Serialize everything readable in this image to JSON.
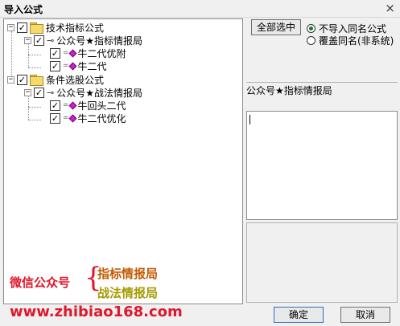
{
  "window": {
    "title": "导入公式",
    "close_glyph": "×"
  },
  "tree": [
    {
      "label": "技术指标公式",
      "expander": "−"
    },
    {
      "label": "公众号★指标情报局",
      "expander": "−"
    },
    {
      "label": "牛二代优附"
    },
    {
      "label": "牛二代"
    },
    {
      "label": "条件选股公式",
      "expander": "−"
    },
    {
      "label": "公众号★战法情报局",
      "expander": "−"
    },
    {
      "label": "牛回头二代"
    },
    {
      "label": "牛二代优化"
    }
  ],
  "check_glyph": "✓",
  "watermark": {
    "wechat": "微信公众号",
    "brace": "{",
    "line1": "指标情报局",
    "line2": "战法情报局",
    "url": "www.zhibiao168.com"
  },
  "select_all_label": "全部选中",
  "options": {
    "no_import": "不导入同名公式",
    "overwrite": "覆盖同名(非系统)"
  },
  "info_title": "公众号★指标情报局",
  "buttons": {
    "ok": "确定",
    "cancel": "取消"
  }
}
